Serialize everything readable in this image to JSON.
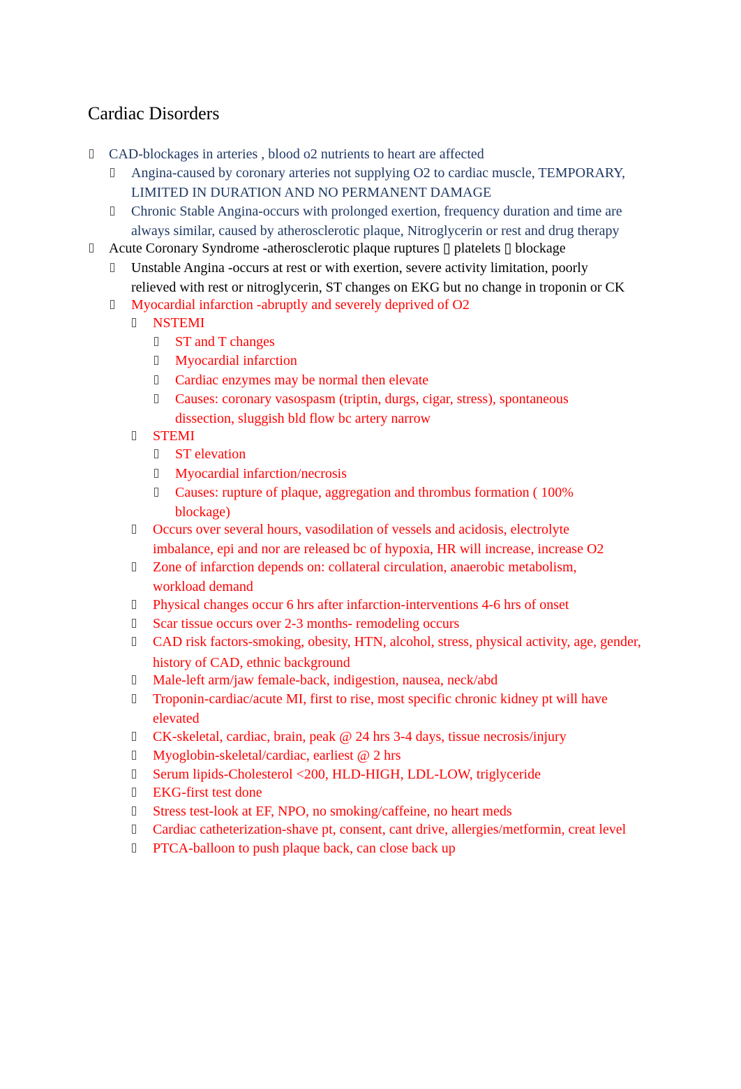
{
  "document": {
    "title": "Cardiac Disorders",
    "colors": {
      "navy": "#1f3864",
      "black": "#000000",
      "red": "#ff0000"
    },
    "bullet_icon": "missing-glyph-box",
    "items": [
      {
        "level": 0,
        "color": "navy",
        "lines": [
          "CAD-blockages in arteries , blood o2 nutrients to heart are affected"
        ]
      },
      {
        "level": 1,
        "color": "navy",
        "lines": [
          "Angina-caused by coronary arteries not supplying O2 to cardiac muscle, TEMPORARY,",
          "LIMITED IN DURATION AND NO PERMANENT DAMAGE"
        ]
      },
      {
        "level": 1,
        "color": "navy",
        "lines": [
          "Chronic Stable Angina-occurs with prolonged exertion, frequency duration and time are",
          "always similar, caused by atherosclerotic plaque, Nitroglycerin or rest and drug therapy"
        ]
      },
      {
        "level": 0,
        "color": "black",
        "lines": [
          "Acute Coronary Syndrome -atherosclerotic plaque ruptures  ▯  platelets ▯ blockage"
        ]
      },
      {
        "level": 1,
        "color": "black",
        "lines": [
          "Unstable Angina -occurs at rest or with exertion, severe activity limitation, poorly",
          "relieved with rest or nitroglycerin, ST changes on EKG but no change in troponin or CK"
        ]
      },
      {
        "level": 1,
        "color": "red",
        "lines": [
          "Myocardial infarction -abruptly and severely deprived of O2"
        ]
      },
      {
        "level": 2,
        "color": "red",
        "lines": [
          "NSTEMI"
        ]
      },
      {
        "level": 3,
        "color": "red",
        "lines": [
          "ST and T changes"
        ]
      },
      {
        "level": 3,
        "color": "red",
        "lines": [
          "Myocardial infarction"
        ]
      },
      {
        "level": 3,
        "color": "red",
        "lines": [
          "Cardiac enzymes may be normal then elevate"
        ]
      },
      {
        "level": 3,
        "color": "red",
        "lines": [
          "Causes: coronary vasospasm (triptin, durgs, cigar, stress), spontaneous",
          "dissection, sluggish bld flow bc artery narrow"
        ]
      },
      {
        "level": 2,
        "color": "red",
        "lines": [
          "STEMI"
        ]
      },
      {
        "level": 3,
        "color": "red",
        "lines": [
          "ST elevation"
        ]
      },
      {
        "level": 3,
        "color": "red",
        "lines": [
          "Myocardial infarction/necrosis"
        ]
      },
      {
        "level": 3,
        "color": "red",
        "lines": [
          "Causes: rupture of plaque, aggregation and thrombus formation ( 100%",
          "blockage)"
        ]
      },
      {
        "level": 2,
        "color": "red",
        "lines": [
          "Occurs over several hours, vasodilation of vessels and acidosis, electrolyte",
          "imbalance, epi and nor are released bc of hypoxia, HR will increase, increase O2"
        ]
      },
      {
        "level": 2,
        "color": "red",
        "lines": [
          "Zone of infarction depends on: collateral circulation, anaerobic metabolism,",
          "workload demand"
        ]
      },
      {
        "level": 2,
        "color": "red",
        "lines": [
          "Physical changes occur 6 hrs after infarction-interventions 4-6 hrs of onset"
        ]
      },
      {
        "level": 2,
        "color": "red",
        "lines": [
          "Scar tissue occurs over 2-3 months- remodeling occurs"
        ]
      },
      {
        "level": 2,
        "color": "red",
        "lines": [
          "CAD risk factors-smoking, obesity, HTN, alcohol, stress, physical activity, age, gender,",
          "history of CAD, ethnic background"
        ]
      },
      {
        "level": 2,
        "color": "red",
        "lines": [
          "Male-left arm/jaw  female-back, indigestion, nausea, neck/abd"
        ]
      },
      {
        "level": 2,
        "color": "red",
        "lines": [
          "Troponin-cardiac/acute MI, first to rise, most specific chronic kidney pt will have",
          "elevated"
        ]
      },
      {
        "level": 2,
        "color": "red",
        "lines": [
          "CK-skeletal, cardiac, brain, peak @ 24 hrs 3-4 days, tissue necrosis/injury"
        ]
      },
      {
        "level": 2,
        "color": "red",
        "lines": [
          "Myoglobin-skeletal/cardiac, earliest @ 2 hrs"
        ]
      },
      {
        "level": 2,
        "color": "red",
        "lines": [
          "Serum lipids-Cholesterol <200, HLD-HIGH, LDL-LOW, triglyceride"
        ]
      },
      {
        "level": 2,
        "color": "red",
        "lines": [
          "EKG-first test done"
        ]
      },
      {
        "level": 2,
        "color": "red",
        "lines": [
          "Stress test-look at EF, NPO, no smoking/caffeine, no heart meds"
        ]
      },
      {
        "level": 2,
        "color": "red",
        "lines": [
          "Cardiac catheterization-shave pt, consent, cant drive, allergies/metformin, creat level"
        ]
      },
      {
        "level": 2,
        "color": "red",
        "lines": [
          "PTCA-balloon to push plaque back, can close back up"
        ]
      }
    ]
  }
}
